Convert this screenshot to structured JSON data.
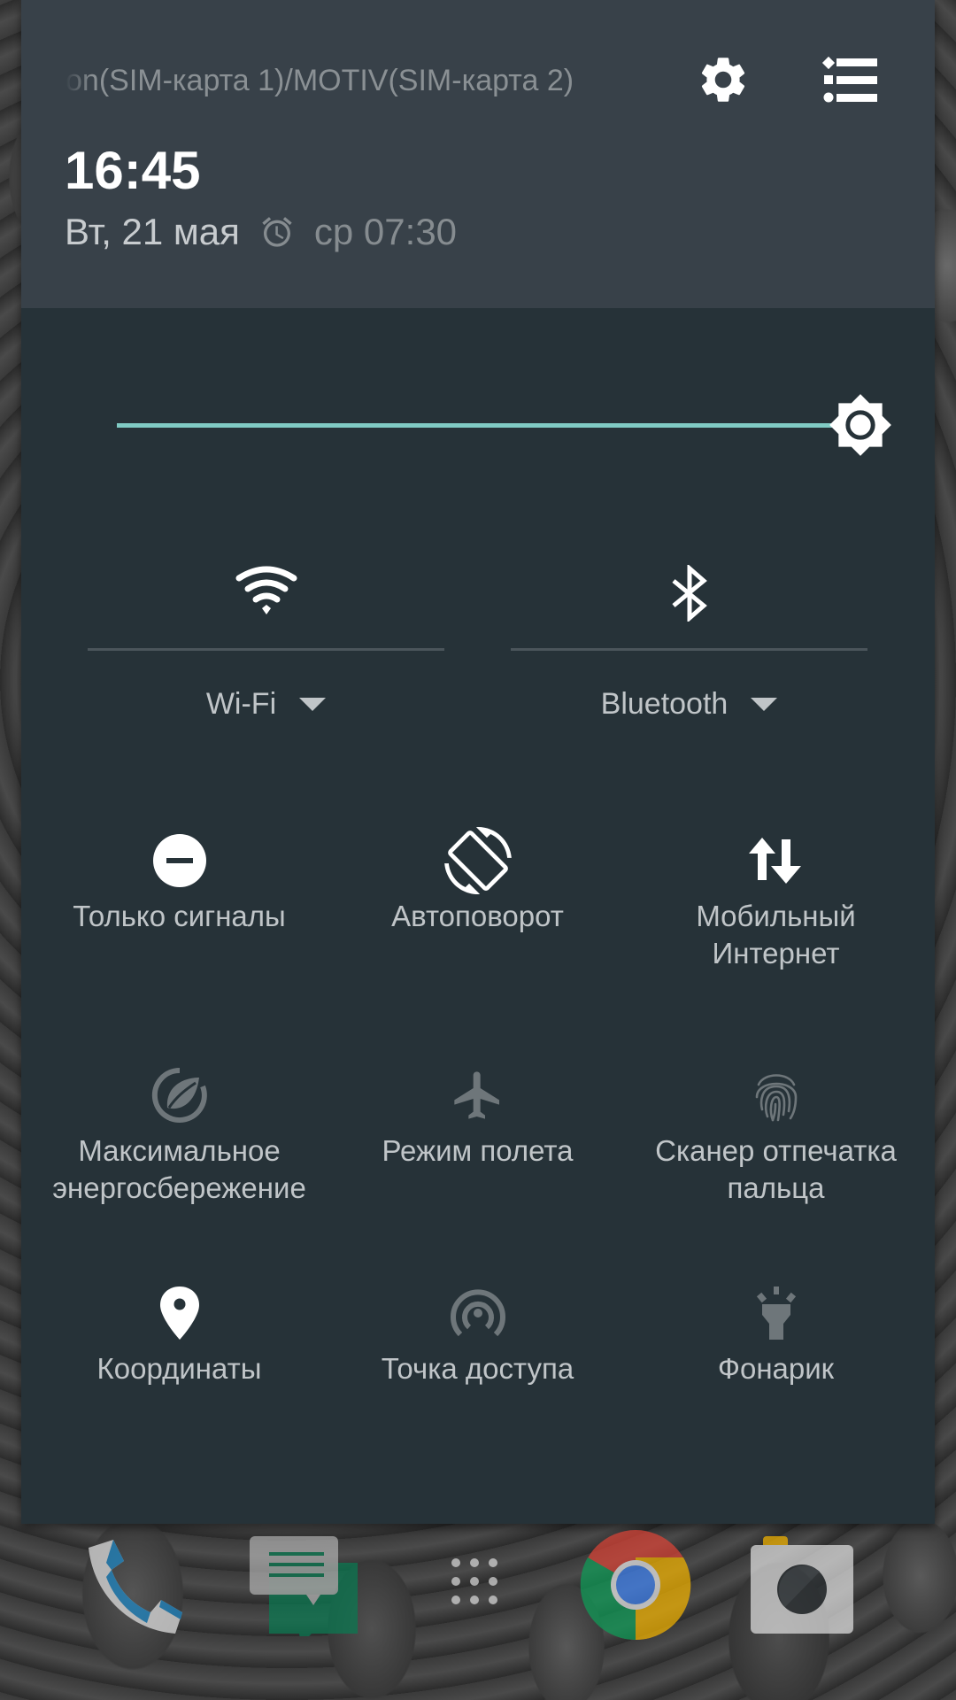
{
  "header": {
    "carrier": "on(SIM-карта 1)/MOTIV(SIM-карта 2)",
    "settings_icon": "gear-icon",
    "edit_icon": "list-icon",
    "clock": "16:45",
    "date": "Вт, 21 мая",
    "alarm_icon": "alarm-clock-icon",
    "alarm": "ср 07:30"
  },
  "brightness": {
    "level": 1.0,
    "icon": "brightness-icon",
    "accent_color": "#80CBC4"
  },
  "big_toggles": [
    {
      "label": "Wi-Fi",
      "icon": "wifi-icon",
      "active": true
    },
    {
      "label": "Bluetooth",
      "icon": "bluetooth-icon",
      "active": true
    }
  ],
  "tiles": [
    {
      "label": "Только сигналы",
      "icon": "do-not-disturb-icon",
      "active": true
    },
    {
      "label": "Автоповорот",
      "icon": "auto-rotate-icon",
      "active": true
    },
    {
      "label": "Мобильный Интернет",
      "icon": "mobile-data-icon",
      "active": true
    },
    {
      "label": "Максимальное энергосбережение",
      "icon": "power-saver-icon",
      "active": false
    },
    {
      "label": "Режим полета",
      "icon": "airplane-icon",
      "active": false
    },
    {
      "label": "Сканер отпечатка пальца",
      "icon": "fingerprint-icon",
      "active": false
    },
    {
      "label": "Координаты",
      "icon": "location-icon",
      "active": true
    },
    {
      "label": "Точка доступа",
      "icon": "hotspot-icon",
      "active": false
    },
    {
      "label": "Фонарик",
      "icon": "flashlight-icon",
      "active": false
    }
  ],
  "dock": [
    {
      "app": "phone",
      "icon": "phone-icon"
    },
    {
      "app": "messages",
      "icon": "messages-icon"
    },
    {
      "app": "app drawer",
      "icon": "app-drawer-icon"
    },
    {
      "app": "chrome",
      "icon": "chrome-icon"
    },
    {
      "app": "camera",
      "icon": "camera-icon"
    }
  ],
  "colors": {
    "header_bg": "#384149",
    "panel_bg": "#263238",
    "active_icon": "#FFFFFF",
    "inactive_icon": "#6E767A",
    "label": "#C0C5C8"
  }
}
